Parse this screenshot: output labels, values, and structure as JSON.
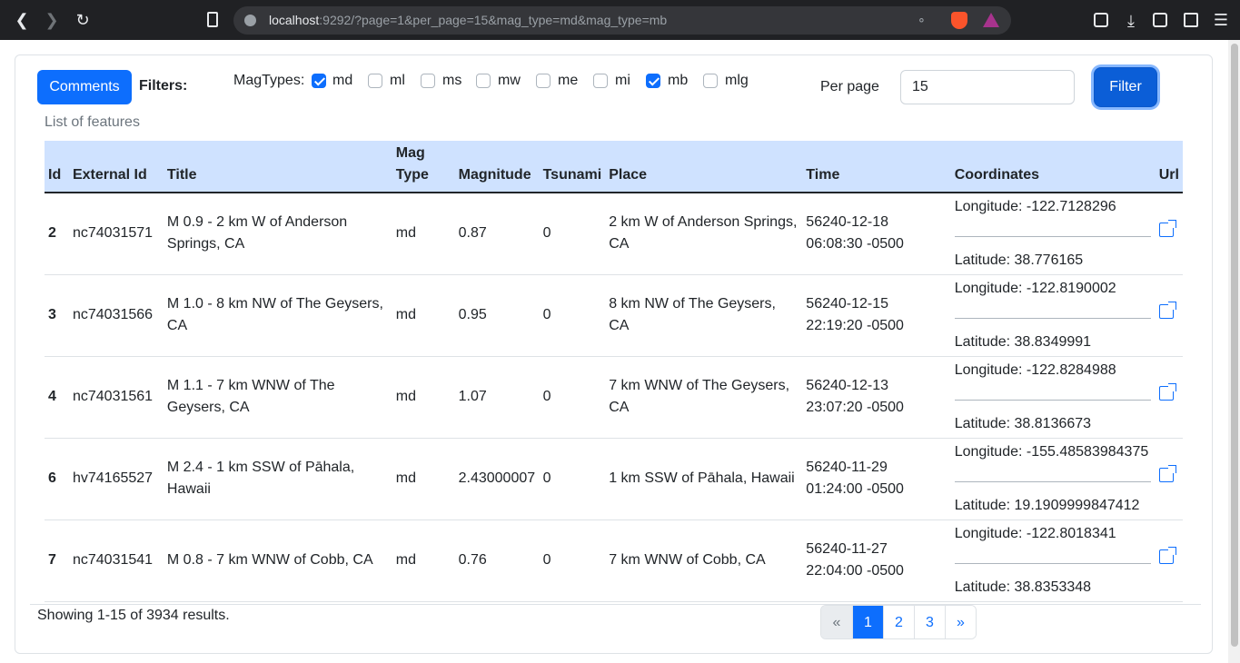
{
  "browser": {
    "url_host": "localhost",
    "url_rest": ":9292/?page=1&per_page=15&mag_type=md&mag_type=mb"
  },
  "toolbar": {
    "comments_label": "Comments",
    "filters_label": "Filters:",
    "magtypes_label": "MagTypes:",
    "mag_types": [
      {
        "label": "md",
        "checked": true
      },
      {
        "label": "ml",
        "checked": false
      },
      {
        "label": "ms",
        "checked": false
      },
      {
        "label": "mw",
        "checked": false
      },
      {
        "label": "me",
        "checked": false
      },
      {
        "label": "mi",
        "checked": false
      },
      {
        "label": "mb",
        "checked": true
      },
      {
        "label": "mlg",
        "checked": false
      }
    ],
    "per_page_label": "Per page",
    "per_page_value": "15",
    "filter_label": "Filter"
  },
  "table": {
    "caption": "List of features",
    "headers": {
      "id": "Id",
      "external_id": "External Id",
      "title": "Title",
      "mag_type_1": "Mag",
      "mag_type_2": "Type",
      "magnitude": "Magnitude",
      "tsunami": "Tsunami",
      "place": "Place",
      "time": "Time",
      "coordinates": "Coordinates",
      "url": "Url"
    },
    "rows": [
      {
        "id": "2",
        "external_id": "nc74031571",
        "title": "M 0.9 - 2 km W of Anderson Springs, CA",
        "mag_type": "md",
        "magnitude": "0.87",
        "tsunami": "0",
        "place": "2 km W of Anderson Springs, CA",
        "time": "56240-12-18 06:08:30 -0500",
        "longitude": "Longitude: -122.7128296",
        "latitude": "Latitude: 38.776165"
      },
      {
        "id": "3",
        "external_id": "nc74031566",
        "title": "M 1.0 - 8 km NW of The Geysers, CA",
        "mag_type": "md",
        "magnitude": "0.95",
        "tsunami": "0",
        "place": "8 km NW of The Geysers, CA",
        "time": "56240-12-15 22:19:20 -0500",
        "longitude": "Longitude: -122.8190002",
        "latitude": "Latitude: 38.8349991"
      },
      {
        "id": "4",
        "external_id": "nc74031561",
        "title": "M 1.1 - 7 km WNW of The Geysers, CA",
        "mag_type": "md",
        "magnitude": "1.07",
        "tsunami": "0",
        "place": "7 km WNW of The Geysers, CA",
        "time": "56240-12-13 23:07:20 -0500",
        "longitude": "Longitude: -122.8284988",
        "latitude": "Latitude: 38.8136673"
      },
      {
        "id": "6",
        "external_id": "hv74165527",
        "title": "M 2.4 - 1 km SSW of Pāhala, Hawaii",
        "mag_type": "md",
        "magnitude": "2.43000007",
        "tsunami": "0",
        "place": "1 km SSW of Pāhala, Hawaii",
        "time": "56240-11-29 01:24:00 -0500",
        "longitude": "Longitude: -155.48583984375",
        "latitude": "Latitude: 19.1909999847412"
      },
      {
        "id": "7",
        "external_id": "nc74031541",
        "title": "M 0.8 - 7 km WNW of Cobb, CA",
        "mag_type": "md",
        "magnitude": "0.76",
        "tsunami": "0",
        "place": "7 km WNW of Cobb, CA",
        "time": "56240-11-27 22:04:00 -0500",
        "longitude": "Longitude: -122.8018341",
        "latitude": "Latitude: 38.8353348"
      }
    ]
  },
  "footer": {
    "showing": "Showing 1-15 of 3934 results.",
    "pages": [
      "«",
      "1",
      "2",
      "3",
      "»"
    ],
    "active_page": "1"
  }
}
